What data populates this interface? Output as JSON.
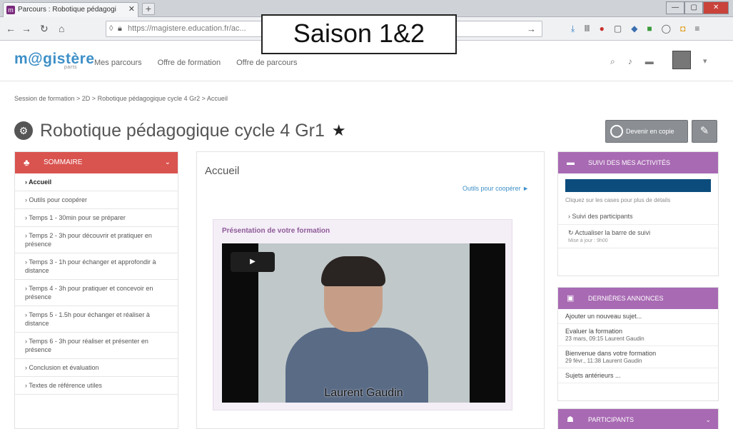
{
  "browser": {
    "tab_title": "Parcours : Robotique pédagogi",
    "tab_favicon": "m",
    "tab_close": "✕",
    "new_tab": "+",
    "url": "https://magistere.education.fr/ac...",
    "win_min": "—",
    "win_max": "▢",
    "win_close": "✕"
  },
  "overlay_label": "Saison 1&2",
  "site": {
    "logo": "m@gistère",
    "logo_sub": "parts",
    "nav": [
      "Mes parcours",
      "Offre de formation",
      "Offre de parcours"
    ]
  },
  "breadcrumb": "Session de formation  >  2D  >  Robotique pédagogique cycle 4 Gr2  >  Accueil",
  "page": {
    "title": "Robotique pédagogique cycle 4 Gr1",
    "follow_button": "Devenir en copie"
  },
  "sommaire": {
    "header": "SOMMAIRE",
    "items": [
      "Accueil",
      "Outils pour coopérer",
      "Temps 1 - 30min pour se préparer",
      "Temps 2 - 3h pour découvrir et pratiquer en présence",
      "Temps 3 - 1h pour échanger et approfondir à distance",
      "Temps 4 - 3h pour pratiquer et concevoir en présence",
      "Temps 5 - 1.5h pour échanger et réaliser à distance",
      "Temps 6 - 3h pour réaliser et présenter en présence",
      "Conclusion et évaluation",
      "Textes de référence utiles"
    ]
  },
  "main": {
    "title": "Accueil",
    "tools_link": "Outils pour coopérer ►",
    "presentation_title": "Présentation de votre formation",
    "video_caption": "Laurent Gaudin"
  },
  "suivi": {
    "header": "SUIVI DES MES ACTIVITÉS",
    "progress": 1.0,
    "hint": "Cliquez sur les cases pour plus de détails",
    "links": [
      "Suivi des participants",
      "Actualiser la barre de suivi"
    ],
    "link2_sub": "Mise à jour : 9h00"
  },
  "annonces": {
    "header": "DERNIÈRES ANNONCES",
    "items": [
      {
        "title": "Ajouter un nouveau sujet...",
        "sub": ""
      },
      {
        "title": "Evaluer la formation",
        "sub": "23 mars, 09:15 Laurent Gaudin"
      },
      {
        "title": "Bienvenue dans votre formation",
        "sub": "29 févr., 11:38 Laurent Gaudin"
      },
      {
        "title": "Sujets antérieurs ...",
        "sub": ""
      }
    ]
  },
  "participants": {
    "header": "PARTICIPANTS"
  },
  "colors": {
    "sommaire": "#d9534f",
    "right_header": "#a86ab3",
    "progress": "#0b4c7c",
    "logo": "#3d8fc7"
  }
}
